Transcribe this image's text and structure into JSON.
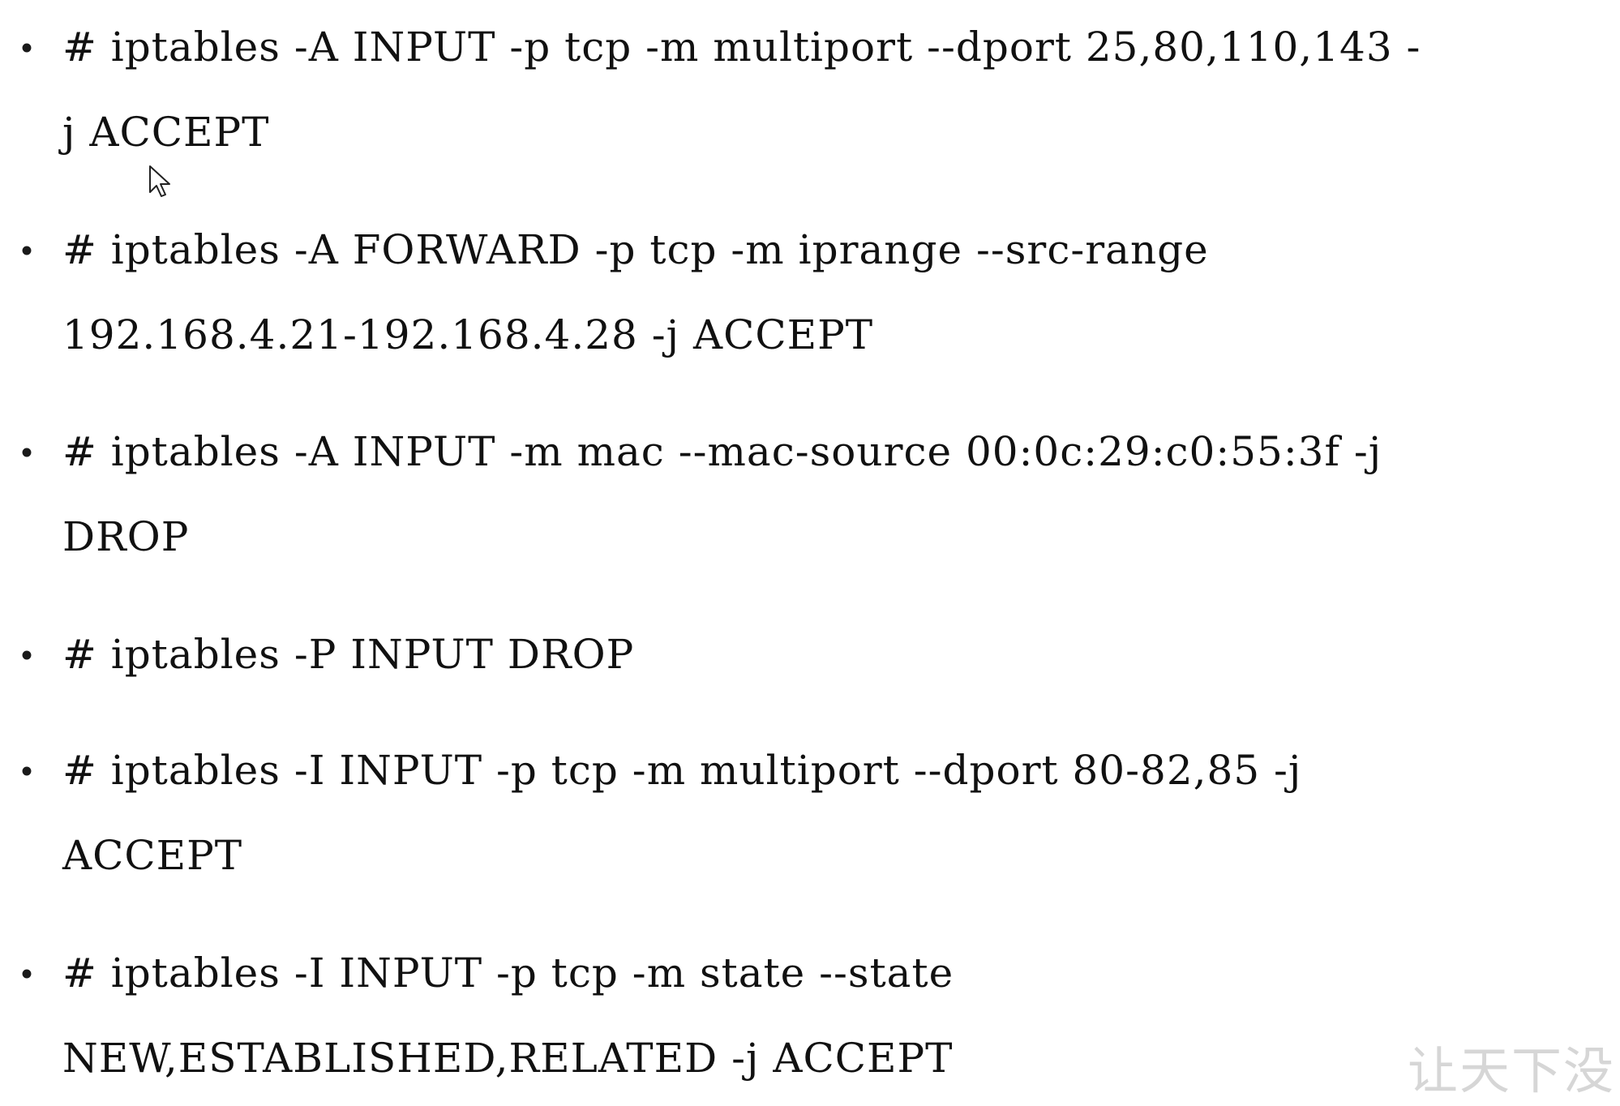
{
  "commands": [
    {
      "line1": "# iptables -A INPUT -p tcp -m multiport --dport 25,80,110,143 -",
      "line2": "j ACCEPT"
    },
    {
      "line1": "# iptables -A FORWARD -p tcp -m iprange --src-range",
      "line2": "192.168.4.21-192.168.4.28 -j ACCEPT"
    },
    {
      "line1": "# iptables -A INPUT -m mac --mac-source 00:0c:29:c0:55:3f -j",
      "line2": "DROP"
    },
    {
      "line1": "# iptables -P INPUT DROP"
    },
    {
      "line1": "# iptables -I INPUT -p tcp -m multiport --dport 80-82,85 -j",
      "line2": "ACCEPT"
    },
    {
      "line1": "# iptables -I INPUT -p tcp -m state --state",
      "line2": "NEW,ESTABLISHED,RELATED -j ACCEPT"
    }
  ],
  "watermark": {
    "text": "让天下没"
  },
  "icons": {
    "cursor": "mouse-pointer-icon"
  }
}
